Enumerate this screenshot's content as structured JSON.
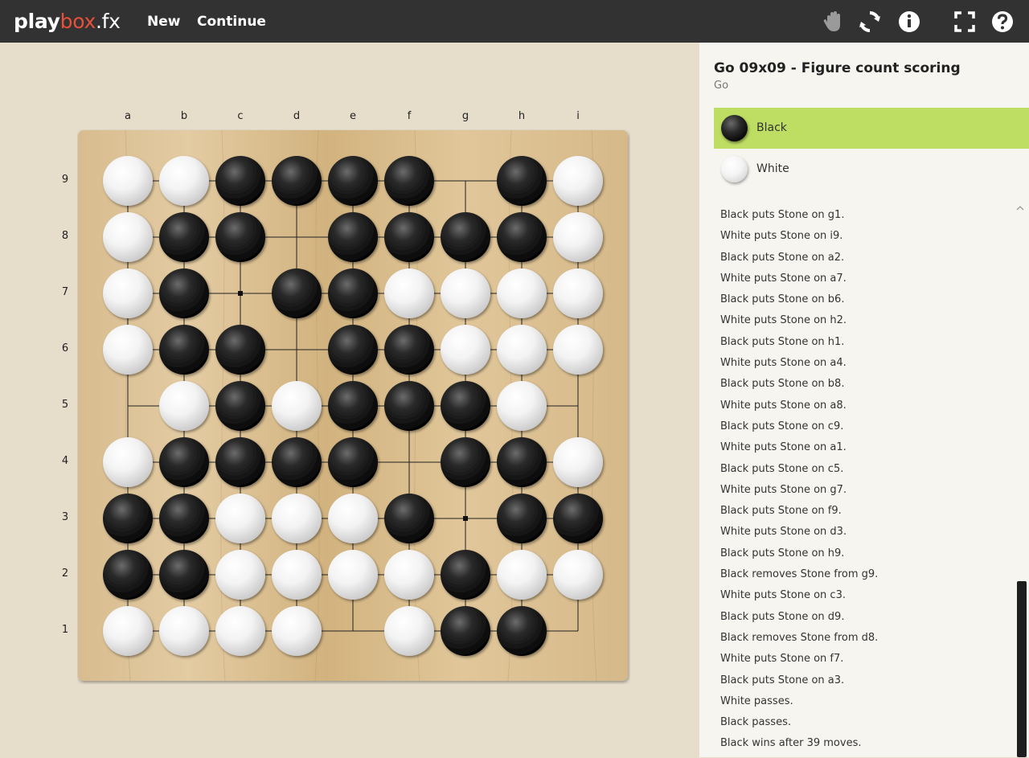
{
  "header": {
    "logo": {
      "play": "play",
      "box": "box",
      "fx": ".fx"
    },
    "nav": [
      "New",
      "Continue"
    ],
    "icons": [
      "hand-icon",
      "refresh-icon",
      "info-icon",
      "fullscreen-icon",
      "help-icon"
    ]
  },
  "game": {
    "title": "Go 09x09 - Figure count scoring",
    "subtitle": "Go"
  },
  "players": [
    {
      "name": "Black",
      "stone": "black",
      "active": true
    },
    {
      "name": "White",
      "stone": "white",
      "active": false
    }
  ],
  "board": {
    "columns": [
      "a",
      "b",
      "c",
      "d",
      "e",
      "f",
      "g",
      "h",
      "i"
    ],
    "rows": [
      "9",
      "8",
      "7",
      "6",
      "5",
      "4",
      "3",
      "2",
      "1"
    ],
    "cells": [
      "WWBBBB.BW",
      "WBB.BBBBW",
      "WB.BBWWWW",
      "WBB.BBWWW",
      ".WBWBBBW.",
      "WBBBB.BBW",
      "BBWWWB.BB",
      "BBWWWWBWW",
      "WWWW.WBB."
    ],
    "star_points": [
      "c7",
      "g7",
      "c3",
      "g3"
    ]
  },
  "history": [
    "Black puts Stone on g1.",
    "White puts Stone on i9.",
    "Black puts Stone on a2.",
    "White puts Stone on a7.",
    "Black puts Stone on b6.",
    "White puts Stone on h2.",
    "Black puts Stone on h1.",
    "White puts Stone on a4.",
    "Black puts Stone on b8.",
    "White puts Stone on a8.",
    "Black puts Stone on c9.",
    "White puts Stone on a1.",
    "Black puts Stone on c5.",
    "White puts Stone on g7.",
    "Black puts Stone on f9.",
    "White puts Stone on d3.",
    "Black puts Stone on h9.",
    "Black removes Stone from g9.",
    "White puts Stone on c3.",
    "Black puts Stone on d9.",
    "Black removes Stone from d8.",
    "White puts Stone on f7.",
    "Black puts Stone on a3.",
    "White passes.",
    "Black passes.",
    "Black wins after 39 moves."
  ],
  "colors": {
    "topbar": "#323232",
    "logo_accent": "#e8503a",
    "active_player": "#bedd63",
    "board_wood": "#dcc196",
    "background": "#e6ddcb",
    "sidebar": "#f7f5ef"
  }
}
